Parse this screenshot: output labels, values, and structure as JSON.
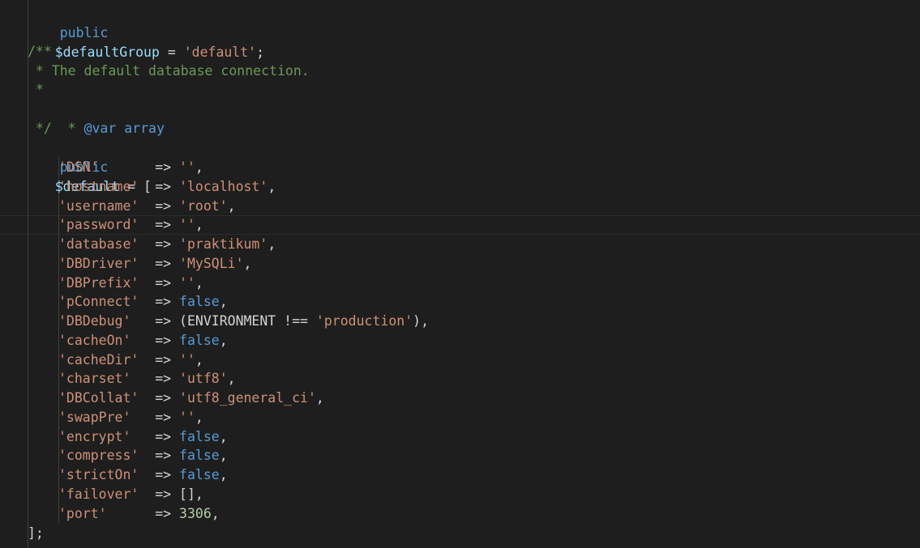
{
  "editor": {
    "theme_colors": {
      "background": "#1e1e1e",
      "keyword": "#569cd6",
      "variable": "#9cdcfe",
      "string": "#ce9178",
      "comment": "#6a9955",
      "number": "#b5cea8",
      "text": "#d4d4d4"
    },
    "lines": [
      {
        "kw": "public",
        "var": "$defaultGroup",
        "op": " = ",
        "str": "'default'",
        "end": ";"
      },
      {
        "blank": ""
      },
      {
        "comment": "/**"
      },
      {
        "comment": " * The default database connection."
      },
      {
        "comment": " *"
      },
      {
        "comment_prefix": " * ",
        "tag": "@var",
        "type": " array"
      },
      {
        "comment": " */"
      },
      {
        "kw": "public",
        "var": "$default",
        "op": " = ",
        "end": "["
      }
    ],
    "config": [
      {
        "key": "'DSN'",
        "pad": "      ",
        "arrow": " => ",
        "value": "''",
        "kind": "str",
        "tail": ","
      },
      {
        "key": "'hostname'",
        "pad": " ",
        "arrow": " => ",
        "value": "'localhost'",
        "kind": "str",
        "tail": ","
      },
      {
        "key": "'username'",
        "pad": " ",
        "arrow": " => ",
        "value": "'root'",
        "kind": "str",
        "tail": ","
      },
      {
        "key": "'password'",
        "pad": " ",
        "arrow": " => ",
        "value": "''",
        "kind": "str",
        "tail": ","
      },
      {
        "key": "'database'",
        "pad": " ",
        "arrow": " => ",
        "value": "'praktikum'",
        "kind": "str",
        "tail": ","
      },
      {
        "key": "'DBDriver'",
        "pad": " ",
        "arrow": " => ",
        "value": "'MySQLi'",
        "kind": "str",
        "tail": ","
      },
      {
        "key": "'DBPrefix'",
        "pad": " ",
        "arrow": " => ",
        "value": "''",
        "kind": "str",
        "tail": ","
      },
      {
        "key": "'pConnect'",
        "pad": " ",
        "arrow": " => ",
        "value": "false",
        "kind": "bool",
        "tail": ","
      },
      {
        "key": "'DBDebug'",
        "pad": "  ",
        "arrow": " => ",
        "value": "(ENVIRONMENT !== ",
        "kind": "const",
        "value2": "'production'",
        "tail": "),"
      },
      {
        "key": "'cacheOn'",
        "pad": "  ",
        "arrow": " => ",
        "value": "false",
        "kind": "bool",
        "tail": ","
      },
      {
        "key": "'cacheDir'",
        "pad": " ",
        "arrow": " => ",
        "value": "''",
        "kind": "str",
        "tail": ","
      },
      {
        "key": "'charset'",
        "pad": "  ",
        "arrow": " => ",
        "value": "'utf8'",
        "kind": "str",
        "tail": ","
      },
      {
        "key": "'DBCollat'",
        "pad": " ",
        "arrow": " => ",
        "value": "'utf8_general_ci'",
        "kind": "str",
        "tail": ","
      },
      {
        "key": "'swapPre'",
        "pad": "  ",
        "arrow": " => ",
        "value": "''",
        "kind": "str",
        "tail": ","
      },
      {
        "key": "'encrypt'",
        "pad": "  ",
        "arrow": " => ",
        "value": "false",
        "kind": "bool",
        "tail": ","
      },
      {
        "key": "'compress'",
        "pad": " ",
        "arrow": " => ",
        "value": "false",
        "kind": "bool",
        "tail": ","
      },
      {
        "key": "'strictOn'",
        "pad": " ",
        "arrow": " => ",
        "value": "false",
        "kind": "bool",
        "tail": ","
      },
      {
        "key": "'failover'",
        "pad": " ",
        "arrow": " => ",
        "value": "[]",
        "kind": "op",
        "tail": ","
      },
      {
        "key": "'port'",
        "pad": "     ",
        "arrow": " => ",
        "value": "3306",
        "kind": "num",
        "tail": ","
      }
    ],
    "closing": "];"
  }
}
